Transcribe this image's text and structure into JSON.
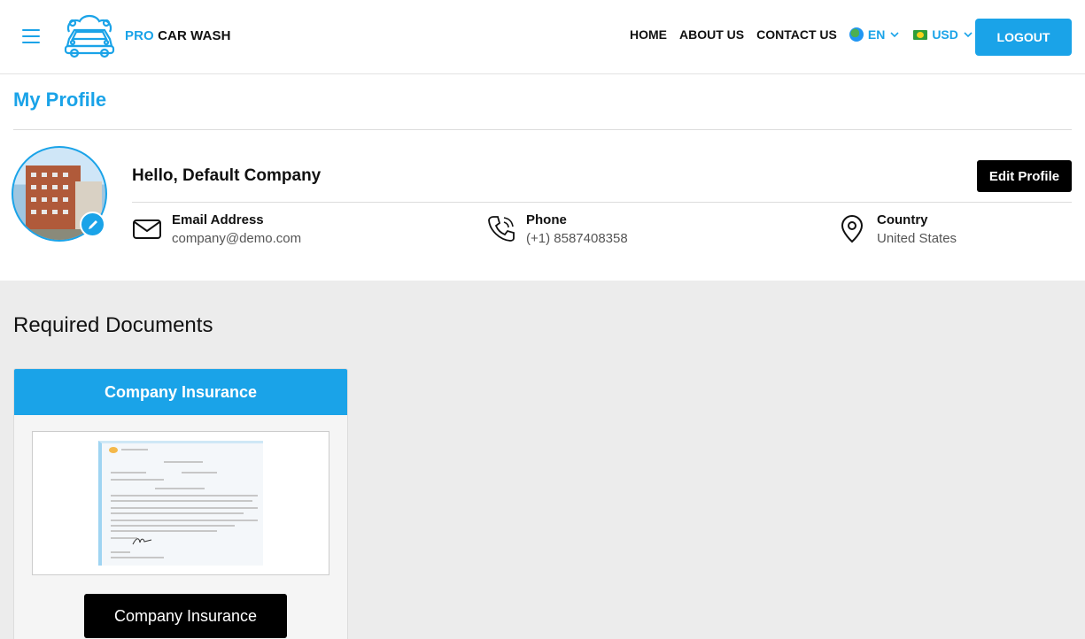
{
  "brand": {
    "pro": "PRO",
    "rest": "CAR WASH"
  },
  "nav": {
    "home": "HOME",
    "about": "ABOUT US",
    "contact": "CONTACT US",
    "language": "EN",
    "currency": "USD",
    "logout": "LOGOUT"
  },
  "profile": {
    "page_title": "My Profile",
    "greeting": "Hello, Default Company",
    "edit_label": "Edit Profile",
    "email_label": "Email Address",
    "email_value": "company@demo.com",
    "phone_label": "Phone",
    "phone_value": "(+1) 8587408358",
    "country_label": "Country",
    "country_value": "United States"
  },
  "documents": {
    "title": "Required Documents",
    "items": [
      {
        "header": "Company Insurance",
        "button_label": "Company Insurance"
      }
    ]
  },
  "colors": {
    "accent": "#1aa3e8",
    "dark_button": "#000000"
  },
  "icons": [
    "hamburger-icon",
    "car-wash-logo-icon",
    "globe-icon",
    "chevron-down-icon",
    "flag-icon",
    "pencil-icon",
    "envelope-icon",
    "phone-icon",
    "location-pin-icon"
  ]
}
